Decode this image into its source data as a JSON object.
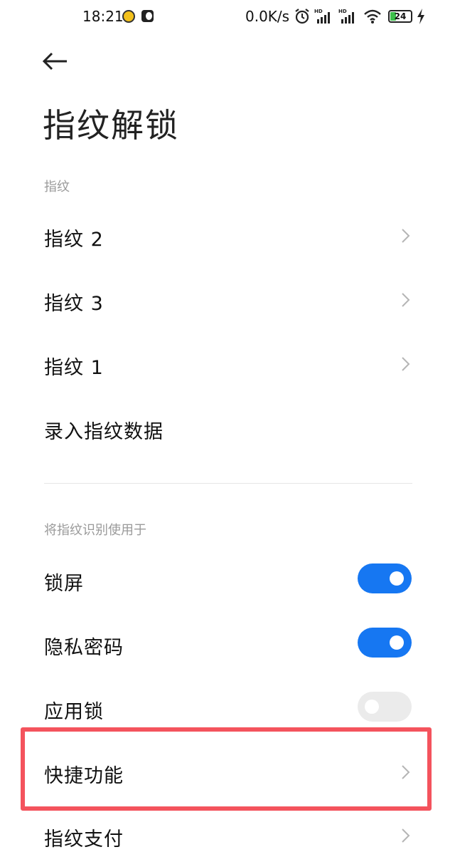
{
  "status_bar": {
    "time": "18:21",
    "network_speed": "0.0K/s",
    "battery_level": "24",
    "icons": [
      "app-notification-icon",
      "moon-icon",
      "alarm-icon",
      "signal-hd-icon",
      "signal-hd-icon",
      "wifi-icon",
      "battery-icon",
      "charging-icon"
    ]
  },
  "header": {
    "back_icon": "back-arrow-icon",
    "title": "指纹解锁"
  },
  "fingerprints_section": {
    "label": "指纹",
    "items": [
      {
        "label": "指纹 2",
        "has_chevron": true
      },
      {
        "label": "指纹 3",
        "has_chevron": true
      },
      {
        "label": "指纹 1",
        "has_chevron": true
      },
      {
        "label": "录入指纹数据",
        "has_chevron": false
      }
    ]
  },
  "usage_section": {
    "label": "将指纹识别使用于",
    "items": [
      {
        "label": "锁屏",
        "control": "toggle",
        "on": true
      },
      {
        "label": "隐私密码",
        "control": "toggle",
        "on": true
      },
      {
        "label": "应用锁",
        "control": "toggle",
        "on": false
      },
      {
        "label": "快捷功能",
        "control": "chevron",
        "highlighted": true
      },
      {
        "label": "指纹支付",
        "control": "chevron"
      }
    ]
  },
  "colors": {
    "toggle_on": "#1677f2",
    "toggle_off": "#ebebeb",
    "highlight": "#f4535d",
    "section_label": "#9a9a9a"
  }
}
